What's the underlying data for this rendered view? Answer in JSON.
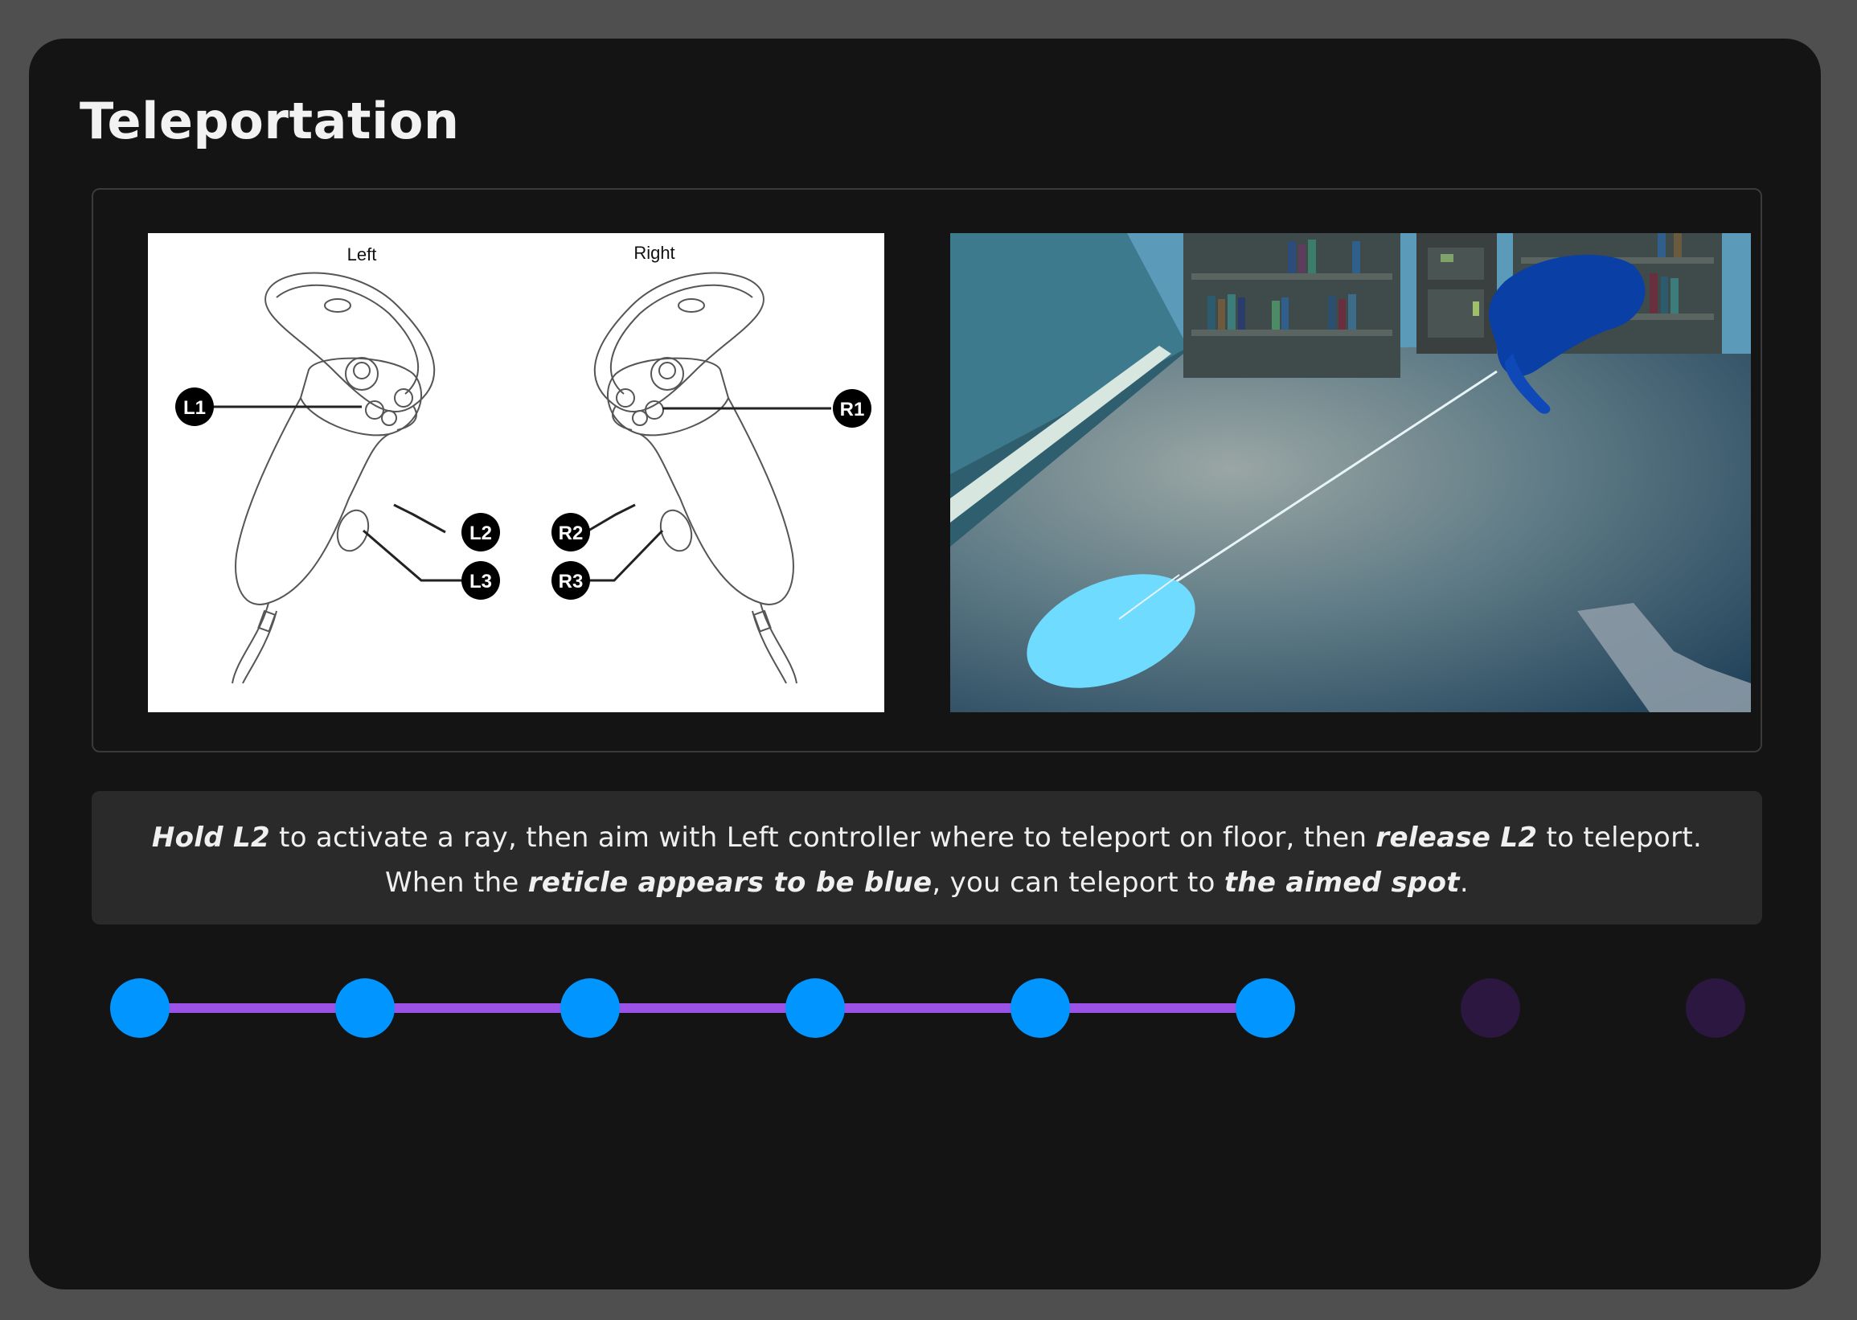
{
  "page": {
    "title": "Teleportation"
  },
  "diagram": {
    "left_label": "Left",
    "right_label": "Right",
    "buttons": {
      "l1": "L1",
      "l2": "L2",
      "l3": "L3",
      "r1": "R1",
      "r2": "R2",
      "r3": "R3"
    }
  },
  "instructions": {
    "line1": {
      "hold": "Hold L2",
      "middle": " to activate a ray, then aim with Left controller where to teleport on floor, then ",
      "release": "release L2",
      "end": " to teleport."
    },
    "line2": {
      "start": "When the ",
      "reticle": "reticle appears to be blue",
      "middle": ", you can teleport to ",
      "spot": "the aimed spot",
      "end": "."
    }
  },
  "progress": {
    "total_steps": 8,
    "completed_steps": 6
  },
  "colors": {
    "background": "#4f4f4f",
    "card": "#141414",
    "step_done": "#0095ff",
    "step_todo": "#2c1740",
    "track": "#9b52e6",
    "reticle": "#6fdcff",
    "hand": "#0a3fa6"
  }
}
